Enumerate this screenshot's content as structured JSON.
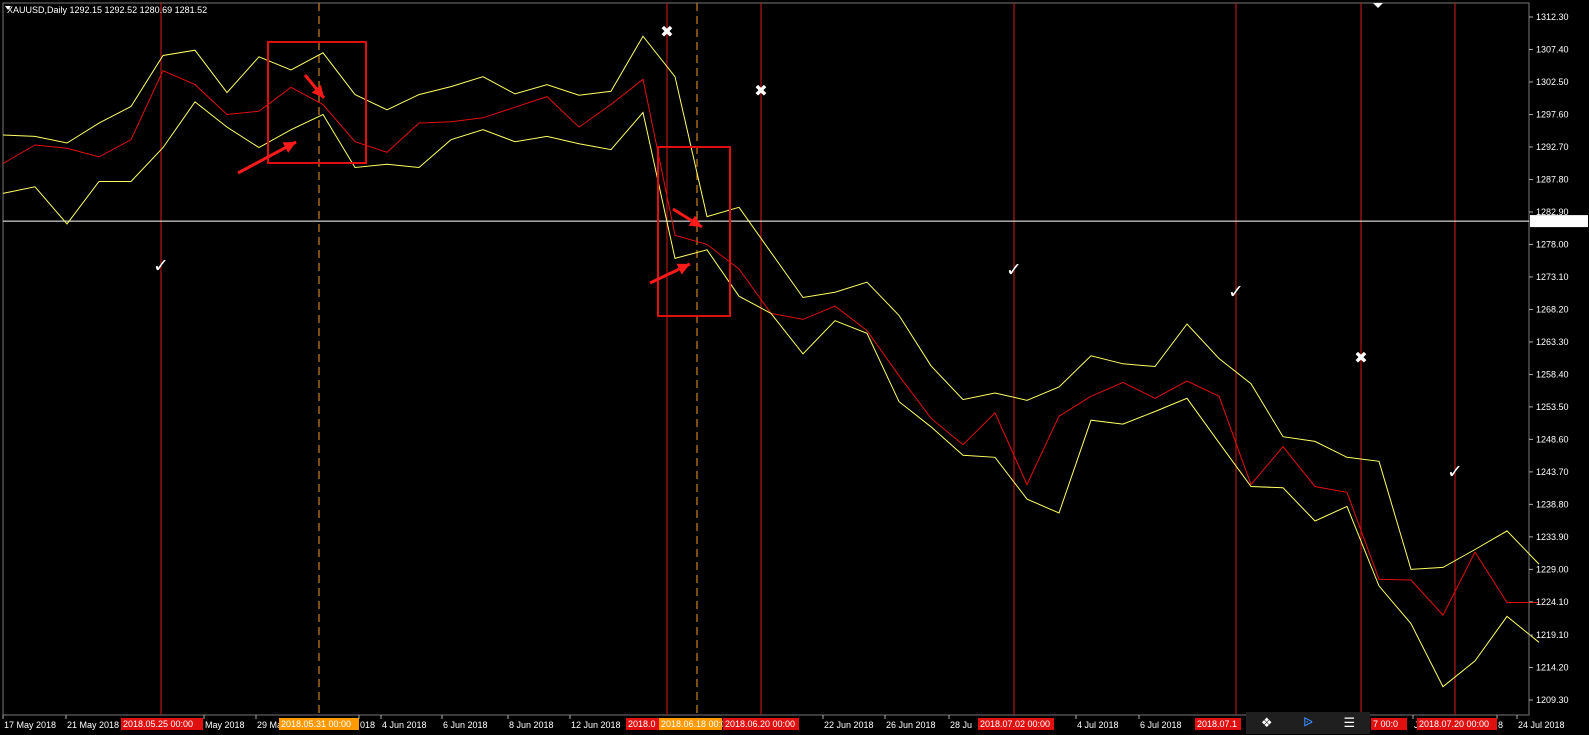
{
  "symbol_header": "XAUUSD,Daily  1292.15 1292.52 1280.69 1281.52",
  "current_price_label": "1281.52",
  "colors": {
    "background": "#000000",
    "upper_band": "#ffff66",
    "lower_band": "#ffff66",
    "middle_line": "#e01010",
    "vline": "#d01818",
    "dashed_vline": "#d08020",
    "current_price_line": "#ffffff",
    "highlight_box": "#e01010",
    "arrow": "#ff1a1a",
    "date_tag_red": "#e01010",
    "date_tag_orange": "#ff9a00"
  },
  "y_axis_labels": [
    "1312.30",
    "1307.40",
    "1302.50",
    "1297.60",
    "1292.70",
    "1287.80",
    "1282.90",
    "1278.00",
    "1273.10",
    "1268.20",
    "1263.30",
    "1258.40",
    "1253.50",
    "1248.60",
    "1243.70",
    "1238.80",
    "1233.90",
    "1229.00",
    "1224.10",
    "1219.10",
    "1214.20",
    "1209.30"
  ],
  "x_axis_labels": [
    "17 May 2018",
    "21 May 2018",
    "May 2018",
    "29 Ma",
    "018",
    "4 Jun 2018",
    "6 Jun 2018",
    "8 Jun 2018",
    "12 Jun 2018",
    "22 Jun 2018",
    "26 Jun 2018",
    "28 Ju",
    "4 Jul 2018",
    "6 Jul 2018",
    "Jul",
    "8",
    "24 Jul 2018"
  ],
  "date_tags": [
    "2018.05.25 00:00",
    "2018.05.31 00:00",
    "2018.0",
    "2018.06.18 00:00",
    "2018.06.20 00:00",
    "2018.07.02 00:00",
    "2018.07.1",
    "7 00:0",
    "2018.07.20 00:00"
  ],
  "signals": [
    "check",
    "check",
    "cross",
    "cross",
    "check",
    "check",
    "cross",
    "check"
  ],
  "chart_data": {
    "type": "line",
    "title": "XAUUSD,Daily",
    "ylim": [
      1209.3,
      1314.0
    ],
    "series": [
      {
        "values": [
          1294.5,
          1294.3,
          1293.3,
          1296.3,
          1298.8,
          1306.5,
          1307.3,
          1300.9,
          1306.3,
          1304.3,
          1306.9,
          1300.6,
          1298.3,
          1300.6,
          1301.8,
          1303.3,
          1300.7,
          1302.1,
          1300.5,
          1301.1,
          1309.4,
          1303.3,
          1282.2,
          1283.6,
          1276.8,
          1270.0,
          1270.8,
          1272.3,
          1267.3,
          1259.7,
          1254.6,
          1255.6,
          1254.5,
          1256.5,
          1261.2,
          1260.0,
          1259.6,
          1266.0,
          1260.8,
          1257.0,
          1249.0,
          1248.3,
          1245.9,
          1245.3,
          1229.0,
          1229.3,
          1232.0,
          1234.8,
          1229.8
        ]
      },
      {
        "values": [
          1290.2,
          1293.0,
          1292.5,
          1291.2,
          1293.8,
          1304.2,
          1302.1,
          1297.6,
          1298.1,
          1301.7,
          1299.1,
          1293.5,
          1291.9,
          1296.3,
          1296.5,
          1297.1,
          1298.7,
          1300.3,
          1295.7,
          1299.1,
          1302.9,
          1279.4,
          1278.0,
          1274.3,
          1267.6,
          1266.7,
          1268.7,
          1265.0,
          1258.2,
          1251.8,
          1247.8,
          1252.6,
          1241.8,
          1252.1,
          1255.1,
          1257.2,
          1254.8,
          1257.4,
          1255.1,
          1241.8,
          1247.5,
          1241.5,
          1240.6,
          1227.5,
          1227.4,
          1222.1,
          1231.6,
          1224.0,
          1224.0
        ]
      },
      {
        "values": [
          1285.7,
          1286.7,
          1281.1,
          1287.5,
          1287.5,
          1292.6,
          1299.5,
          1295.7,
          1292.6,
          1295.3,
          1297.6,
          1289.6,
          1290.1,
          1289.6,
          1293.8,
          1295.3,
          1293.5,
          1294.3,
          1293.2,
          1292.3,
          1297.9,
          1275.9,
          1277.2,
          1270.2,
          1267.6,
          1261.5,
          1266.5,
          1264.6,
          1254.3,
          1250.5,
          1246.2,
          1245.9,
          1239.6,
          1237.5,
          1251.5,
          1250.9,
          1252.8,
          1254.8,
          1248.1,
          1241.5,
          1241.3,
          1236.3,
          1238.5,
          1226.5,
          1220.8,
          1211.3,
          1215.2,
          1221.9,
          1218.0
        ]
      }
    ]
  }
}
